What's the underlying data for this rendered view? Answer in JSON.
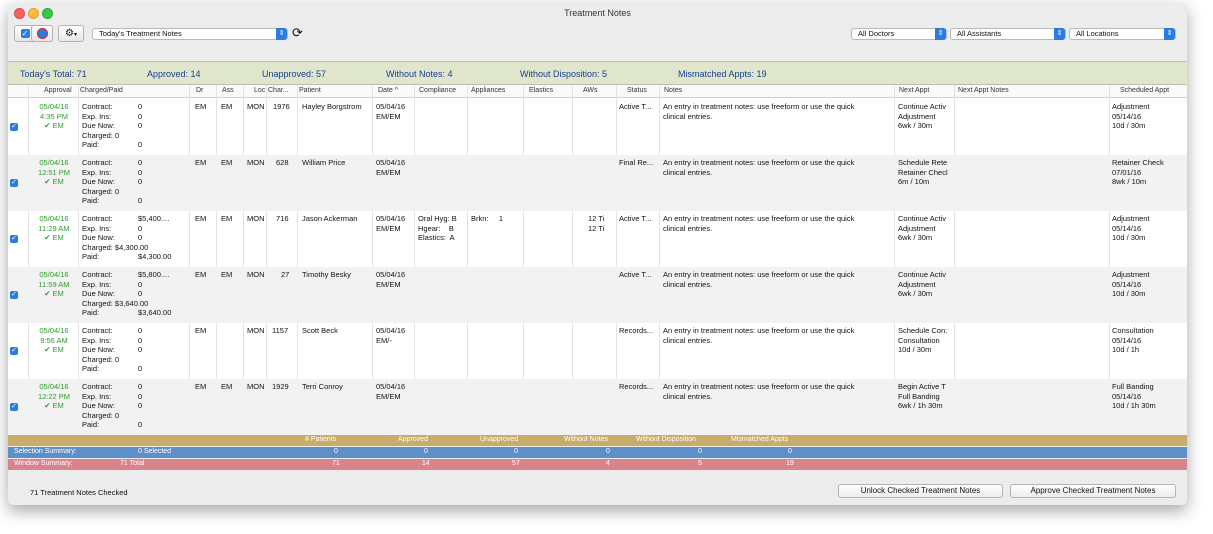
{
  "window": {
    "title": "Treatment Notes"
  },
  "toolbar": {
    "view_select": "Today's Treatment Notes",
    "doctors_select": "All Doctors",
    "assistants_select": "All Assistants",
    "locations_select": "All Locations"
  },
  "summary": {
    "total": "Today's Total:  71",
    "approved": "Approved:  14",
    "unapproved": "Unapproved:  57",
    "without_notes": "Without Notes:  4",
    "without_disposition": "Without Disposition:  5",
    "mismatched": "Mismatched Appts:  19"
  },
  "columns": [
    "Approval",
    "Charged/Paid",
    "Dr",
    "Ass",
    "Loc",
    "Char...",
    "Patient",
    "Date  ^",
    "Compliance",
    "Appliances",
    "Elastics",
    "AWs",
    "Status",
    "Notes",
    "Next Appt",
    "Next Appt Notes",
    "Scheduled Appt"
  ],
  "rows": [
    {
      "approval": "05/04/16\n4:35 PM\n✔ EM",
      "charged": "Contract:\nExp. Ins:\nDue Now:\nCharged: 0\nPaid:",
      "charged_vals": "0\n0\n0\n\n0",
      "dr": "EM",
      "ass": "EM",
      "loc": "MON",
      "chart": "1976",
      "patient": "Hayley Borgstrom",
      "date": "05/04/16\nEM/EM",
      "compliance": "",
      "appliances": "",
      "elastics": "",
      "aws": "",
      "status": "Active T...",
      "notes": "An entry in treatment notes: use freeform or use the quick\nclinical entries.",
      "next": "Continue Activ\nAdjustment\n6wk / 30m",
      "next_notes": "",
      "scheduled": "Adjustment\n05/14/16\n10d / 30m"
    },
    {
      "approval": "05/04/16\n12:51 PM\n✔ EM",
      "charged": "Contract:\nExp. Ins:\nDue Now:\nCharged: 0\nPaid:",
      "charged_vals": "0\n0\n0\n\n0",
      "dr": "EM",
      "ass": "EM",
      "loc": "MON",
      "chart": "628",
      "patient": "William Price",
      "date": "05/04/16\nEM/EM",
      "compliance": "",
      "appliances": "",
      "elastics": "",
      "aws": "",
      "status": "Final Re...",
      "notes": "An entry in treatment notes: use freeform or use the quick\nclinical entries.",
      "next": "Schedule Rete\nRetainer Checl\n6m / 10m",
      "next_notes": "",
      "scheduled": "Retainer Check\n07/01/16\n8wk / 10m"
    },
    {
      "approval": "05/04/16\n11:29 AM\n✔ EM",
      "charged": "Contract:\nExp. Ins:\nDue Now:\nCharged: $4,300.00\nPaid:",
      "charged_vals": "$5,400....\n0\n0\n\n$4,300.00",
      "dr": "EM",
      "ass": "EM",
      "loc": "MON",
      "chart": "716",
      "patient": "Jason Ackerman",
      "date": "05/04/16\nEM/EM",
      "compliance": "Oral Hyg: B\nHgear:    B\nElastics:  A",
      "appliances": "Brkn:     1",
      "elastics": "",
      "aws": "12 Ti\n12 Ti",
      "status": "Active T...",
      "notes": "An entry in treatment notes: use freeform or use the quick\nclinical entries.",
      "next": "Continue Activ\nAdjustment\n6wk / 30m",
      "next_notes": "",
      "scheduled": "Adjustment\n05/14/16\n10d / 30m"
    },
    {
      "approval": "05/04/16\n11:59 AM\n✔ EM",
      "charged": "Contract:\nExp. Ins:\nDue Now:\nCharged: $3,640.00\nPaid:",
      "charged_vals": "$5,800....\n0\n0\n\n$3,640.00",
      "dr": "EM",
      "ass": "EM",
      "loc": "MON",
      "chart": "27",
      "patient": "Timothy Besky",
      "date": "05/04/16\nEM/EM",
      "compliance": "",
      "appliances": "",
      "elastics": "",
      "aws": "",
      "status": "Active T...",
      "notes": "An entry in treatment notes: use freeform or use the quick\nclinical entries.",
      "next": "Continue Activ\nAdjustment\n6wk / 30m",
      "next_notes": "",
      "scheduled": "Adjustment\n05/14/16\n10d / 30m"
    },
    {
      "approval": "05/04/16\n9:56 AM\n✔ EM",
      "charged": "Contract:\nExp. Ins:\nDue Now:\nCharged: 0\nPaid:",
      "charged_vals": "0\n0\n0\n\n0",
      "dr": "EM",
      "ass": "",
      "loc": "MON",
      "chart": "1157",
      "patient": "Scott Beck",
      "date": "05/04/16\nEM/-",
      "compliance": "",
      "appliances": "",
      "elastics": "",
      "aws": "",
      "status": "Records...",
      "notes": "An entry in treatment notes: use freeform or use the quick\nclinical entries.",
      "next": "Schedule Con:\nConsultation\n10d / 30m",
      "next_notes": "",
      "scheduled": "Consultation\n05/14/16\n10d / 1h"
    },
    {
      "approval": "05/04/16\n12:22 PM\n✔ EM",
      "charged": "Contract:\nExp. Ins:\nDue Now:\nCharged: 0\nPaid:",
      "charged_vals": "0\n0\n0\n\n0",
      "dr": "EM",
      "ass": "EM",
      "loc": "MON",
      "chart": "1929",
      "patient": "Terri Conroy",
      "date": "05/04/16\nEM/EM",
      "compliance": "",
      "appliances": "",
      "elastics": "",
      "aws": "",
      "status": "Records...",
      "notes": "An entry in treatment notes: use freeform or use the quick\nclinical entries.",
      "next": "Begin Active T\nFull Banding\n6wk / 1h 30m",
      "next_notes": "",
      "scheduled": "Full Banding\n05/14/16\n10d / 1h 30m"
    }
  ],
  "bands": {
    "headers": {
      "patients": "# Patients",
      "approved": "Approved",
      "unapproved": "Unapproved",
      "without_notes": "Without Notes",
      "without_disposition": "Without Disposition",
      "mismatched": "Mismatched Appts"
    },
    "selection": {
      "label": "Selection Summary:",
      "count": "0 Selected",
      "patients": "0",
      "approved": "0",
      "unapproved": "0",
      "without_notes": "0",
      "without_disposition": "0",
      "mismatched": "0"
    },
    "window": {
      "label": "Window Summary:",
      "count": "71 Total",
      "patients": "71",
      "approved": "14",
      "unapproved": "57",
      "without_notes": "4",
      "without_disposition": "5",
      "mismatched": "19"
    }
  },
  "footer": {
    "status": "71 Treatment Notes Checked",
    "unlock_button": "Unlock Checked Treatment Notes",
    "approve_button": "Approve Checked Treatment Notes"
  }
}
